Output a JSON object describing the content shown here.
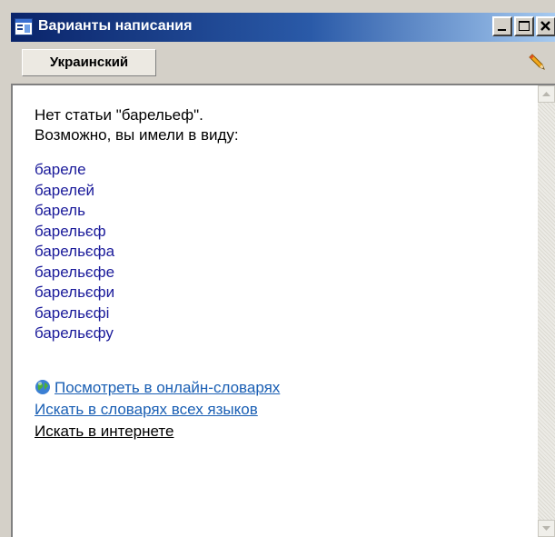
{
  "window": {
    "title": "Варианты написания",
    "controls": {
      "minimize_icon": "minimize-icon",
      "maximize_icon": "maximize-icon",
      "close_icon": "close-icon"
    }
  },
  "toolbar": {
    "language_button": "Украинский",
    "edit_icon": "pencil-icon"
  },
  "content": {
    "message_line1": "Нет статьи \"барельеф\".",
    "message_line2": "Возможно, вы имели в виду:",
    "suggestions": [
      "бареле",
      "барелей",
      "барель",
      "барельєф",
      "барельєфа",
      "барельєфе",
      "барельєфи",
      "барельєфі",
      "барельєфу"
    ],
    "links": {
      "online_dictionaries": "Посмотреть в онлайн-словарях",
      "all_languages": "Искать в словарях всех языков",
      "internet": "Искать в интернете"
    }
  },
  "colors": {
    "titlebar_start": "#0a246a",
    "titlebar_end": "#a6caf0",
    "suggestion_text": "#1a1a9a",
    "link_text": "#1a5fb4"
  }
}
